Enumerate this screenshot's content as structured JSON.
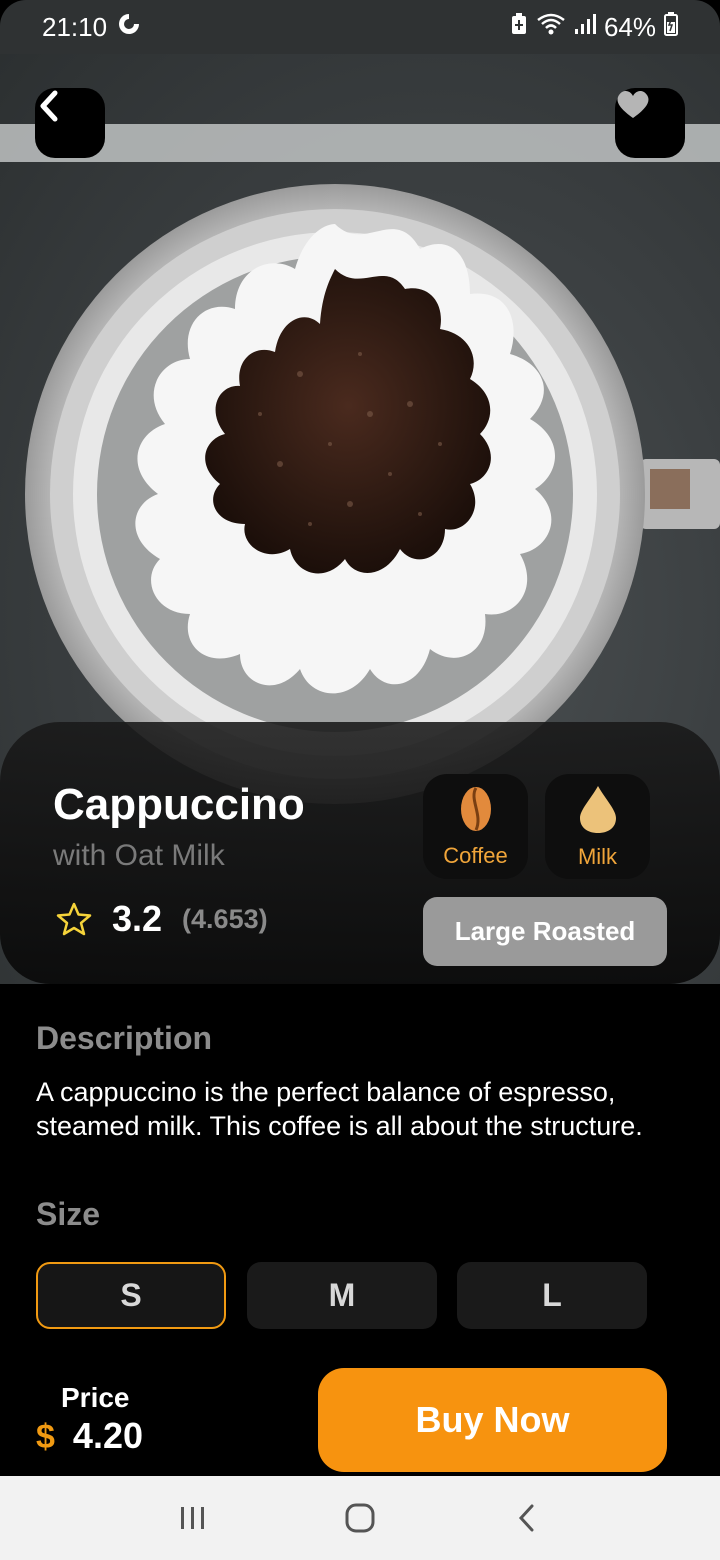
{
  "status_bar": {
    "time": "21:10",
    "battery": "64%"
  },
  "hero": {
    "back_icon": "chevron-left-icon",
    "favorite_icon": "heart-icon"
  },
  "product": {
    "name": "Cappuccino",
    "subtitle": "with Oat Milk",
    "rating": "3.2",
    "rating_count": "(4.653)",
    "ingredients": [
      {
        "label": "Coffee",
        "icon": "coffee-bean-icon"
      },
      {
        "label": "Milk",
        "icon": "milk-drop-icon"
      }
    ],
    "roast": "Large Roasted"
  },
  "description": {
    "title": "Description",
    "text": "A cappuccino is the perfect balance of espresso, steamed milk. This coffee is all about the structure."
  },
  "size": {
    "title": "Size",
    "options": [
      "S",
      "M",
      "L"
    ],
    "selected": "S"
  },
  "price": {
    "label": "Price",
    "currency": "$",
    "value": "4.20"
  },
  "buy_button": "Buy Now",
  "colors": {
    "accent": "#f7930f",
    "background": "#000000",
    "muted_text": "#8c8c8c"
  }
}
